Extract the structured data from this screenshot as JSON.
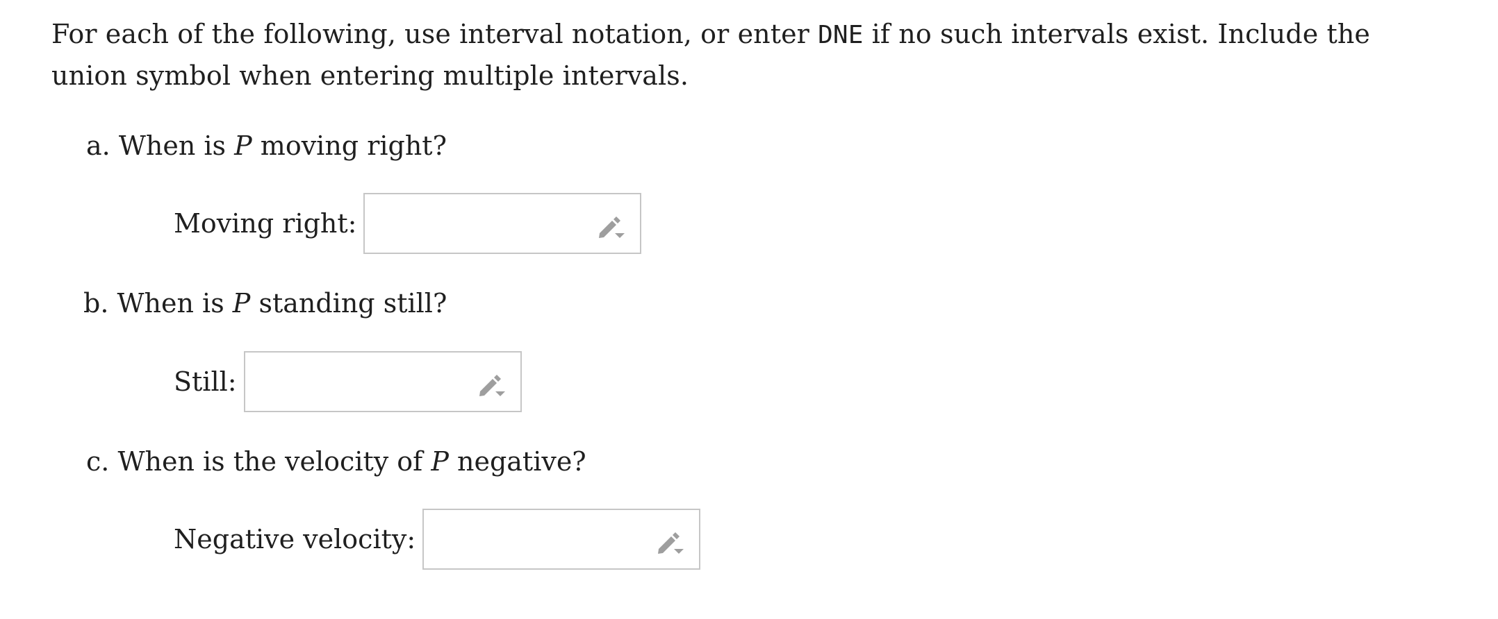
{
  "instructions": {
    "before_code": "For each of the following, use interval notation, or enter ",
    "code": "DNE",
    "after_code": " if no such intervals exist. Include the union symbol when entering multiple intervals."
  },
  "questions": [
    {
      "prefix": "a. When is ",
      "variable": "P",
      "suffix": " moving right?",
      "answer_label": "Moving right:",
      "answer_value": "",
      "answer_placeholder": ""
    },
    {
      "prefix": "b. When is ",
      "variable": "P",
      "suffix": " standing still?",
      "answer_label": "Still:",
      "answer_value": "",
      "answer_placeholder": ""
    },
    {
      "prefix": "c. When is the velocity of ",
      "variable": "P",
      "suffix": " negative?",
      "answer_label": "Negative velocity:",
      "answer_value": "",
      "answer_placeholder": ""
    }
  ],
  "icons": {
    "answer_tool": "pencil-dropdown-icon"
  },
  "colors": {
    "text": "#1f1f1f",
    "border": "#c6c6c6",
    "icon": "#9e9e9e"
  }
}
